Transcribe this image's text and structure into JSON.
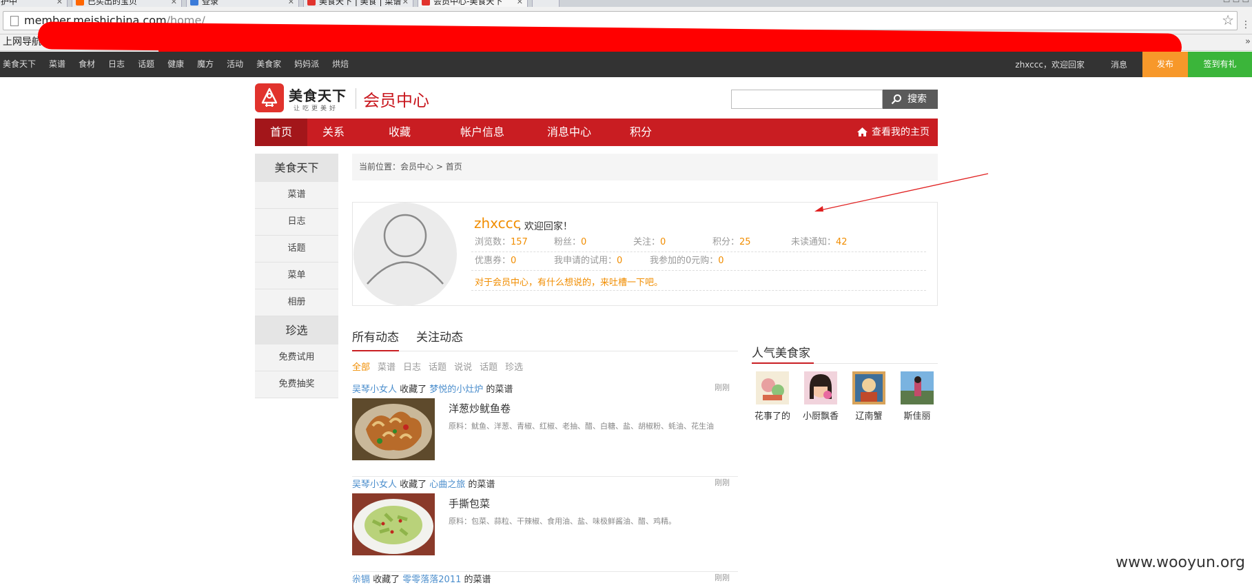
{
  "browser": {
    "tabs": [
      {
        "label": "护中"
      },
      {
        "label": "已买出的宝贝"
      },
      {
        "label": "登录"
      },
      {
        "label": "美食天下 | 美食 | 菜谱"
      },
      {
        "label": "会员中心-美食天下"
      }
    ],
    "url_host": "member.meishichina.com",
    "url_path": "/home/",
    "bookmark_first": "上网导航"
  },
  "site_topbar": {
    "nav": [
      "美食天下",
      "菜谱",
      "食材",
      "日志",
      "话题",
      "健康",
      "魔方",
      "活动",
      "美食家",
      "妈妈派",
      "烘焙"
    ],
    "user_greeting": "zhxccc，欢迎回家",
    "messages": "消息",
    "publish": "发布",
    "sign_in": "签到有礼",
    "publish_color": "#f7982a",
    "sign_color": "#3bb53a"
  },
  "header": {
    "logo_text": "美食天下",
    "logo_slogan": "让吃更美好",
    "section_title": "会员中心",
    "search_button": "搜索",
    "search_placeholder": ""
  },
  "main_nav": {
    "items": [
      "首页",
      "关系",
      "收藏",
      "帐户信息",
      "消息中心",
      "积分"
    ],
    "home_link": "查看我的主页",
    "accent_color": "#c91d22"
  },
  "sidebar": {
    "group1_title": "美食天下",
    "group1_items": [
      "菜谱",
      "日志",
      "话题",
      "菜单",
      "相册"
    ],
    "group2_title": "珍选",
    "group2_items": [
      "免费试用",
      "免费抽奖"
    ]
  },
  "breadcrumb": {
    "prefix": "当前位置：",
    "path": "会员中心 > 首页"
  },
  "profile": {
    "username": "zhxccc",
    "welcome": ", 欢迎回家！",
    "stats1": [
      {
        "label": "浏览数：",
        "value": "157"
      },
      {
        "label": "粉丝：",
        "value": "0"
      },
      {
        "label": "关注：",
        "value": "0"
      },
      {
        "label": "积分：",
        "value": "25"
      },
      {
        "label": "未读通知：",
        "value": "42"
      }
    ],
    "stats2": [
      {
        "label": "优惠券：",
        "value": "0"
      },
      {
        "label": "我申请的试用：",
        "value": "0"
      },
      {
        "label": "我参加的0元购：",
        "value": "0"
      }
    ],
    "feedback": "对于会员中心，有什么想说的，来吐槽一下吧。"
  },
  "feed": {
    "tab_all": "所有动态",
    "tab_follow": "关注动态",
    "filters": [
      "全部",
      "菜谱",
      "日志",
      "话题",
      "说说",
      "话题",
      "珍选"
    ],
    "items": [
      {
        "user": "吴琴小女人",
        "action": " 收藏了 ",
        "target": "梦悦的小灶炉",
        "suffix": " 的菜谱",
        "time": "刚刚",
        "title": "洋葱炒鱿鱼卷",
        "ingredients": "原料：鱿鱼、洋葱、青椒、红椒、老抽、醋、白糖、盐、胡椒粉、蚝油、花生油"
      },
      {
        "user": "吴琴小女人",
        "action": " 收藏了 ",
        "target": "心曲之旅",
        "suffix": " 的菜谱",
        "time": "刚刚",
        "title": "手撕包菜",
        "ingredients": "原料：包菜、蒜粒、干辣椒、食用油、盐、味极鲜酱油、醋、鸡精。"
      },
      {
        "user": "尜镉",
        "action": " 收藏了 ",
        "target": "零零落落2011",
        "suffix": " 的菜谱",
        "time": "刚刚"
      }
    ]
  },
  "popular": {
    "title": "人气美食家",
    "cooks": [
      "花事了的",
      "小厨飘香",
      "辽南蟹",
      "斯佳丽"
    ]
  },
  "watermark": "www.wooyun.org"
}
